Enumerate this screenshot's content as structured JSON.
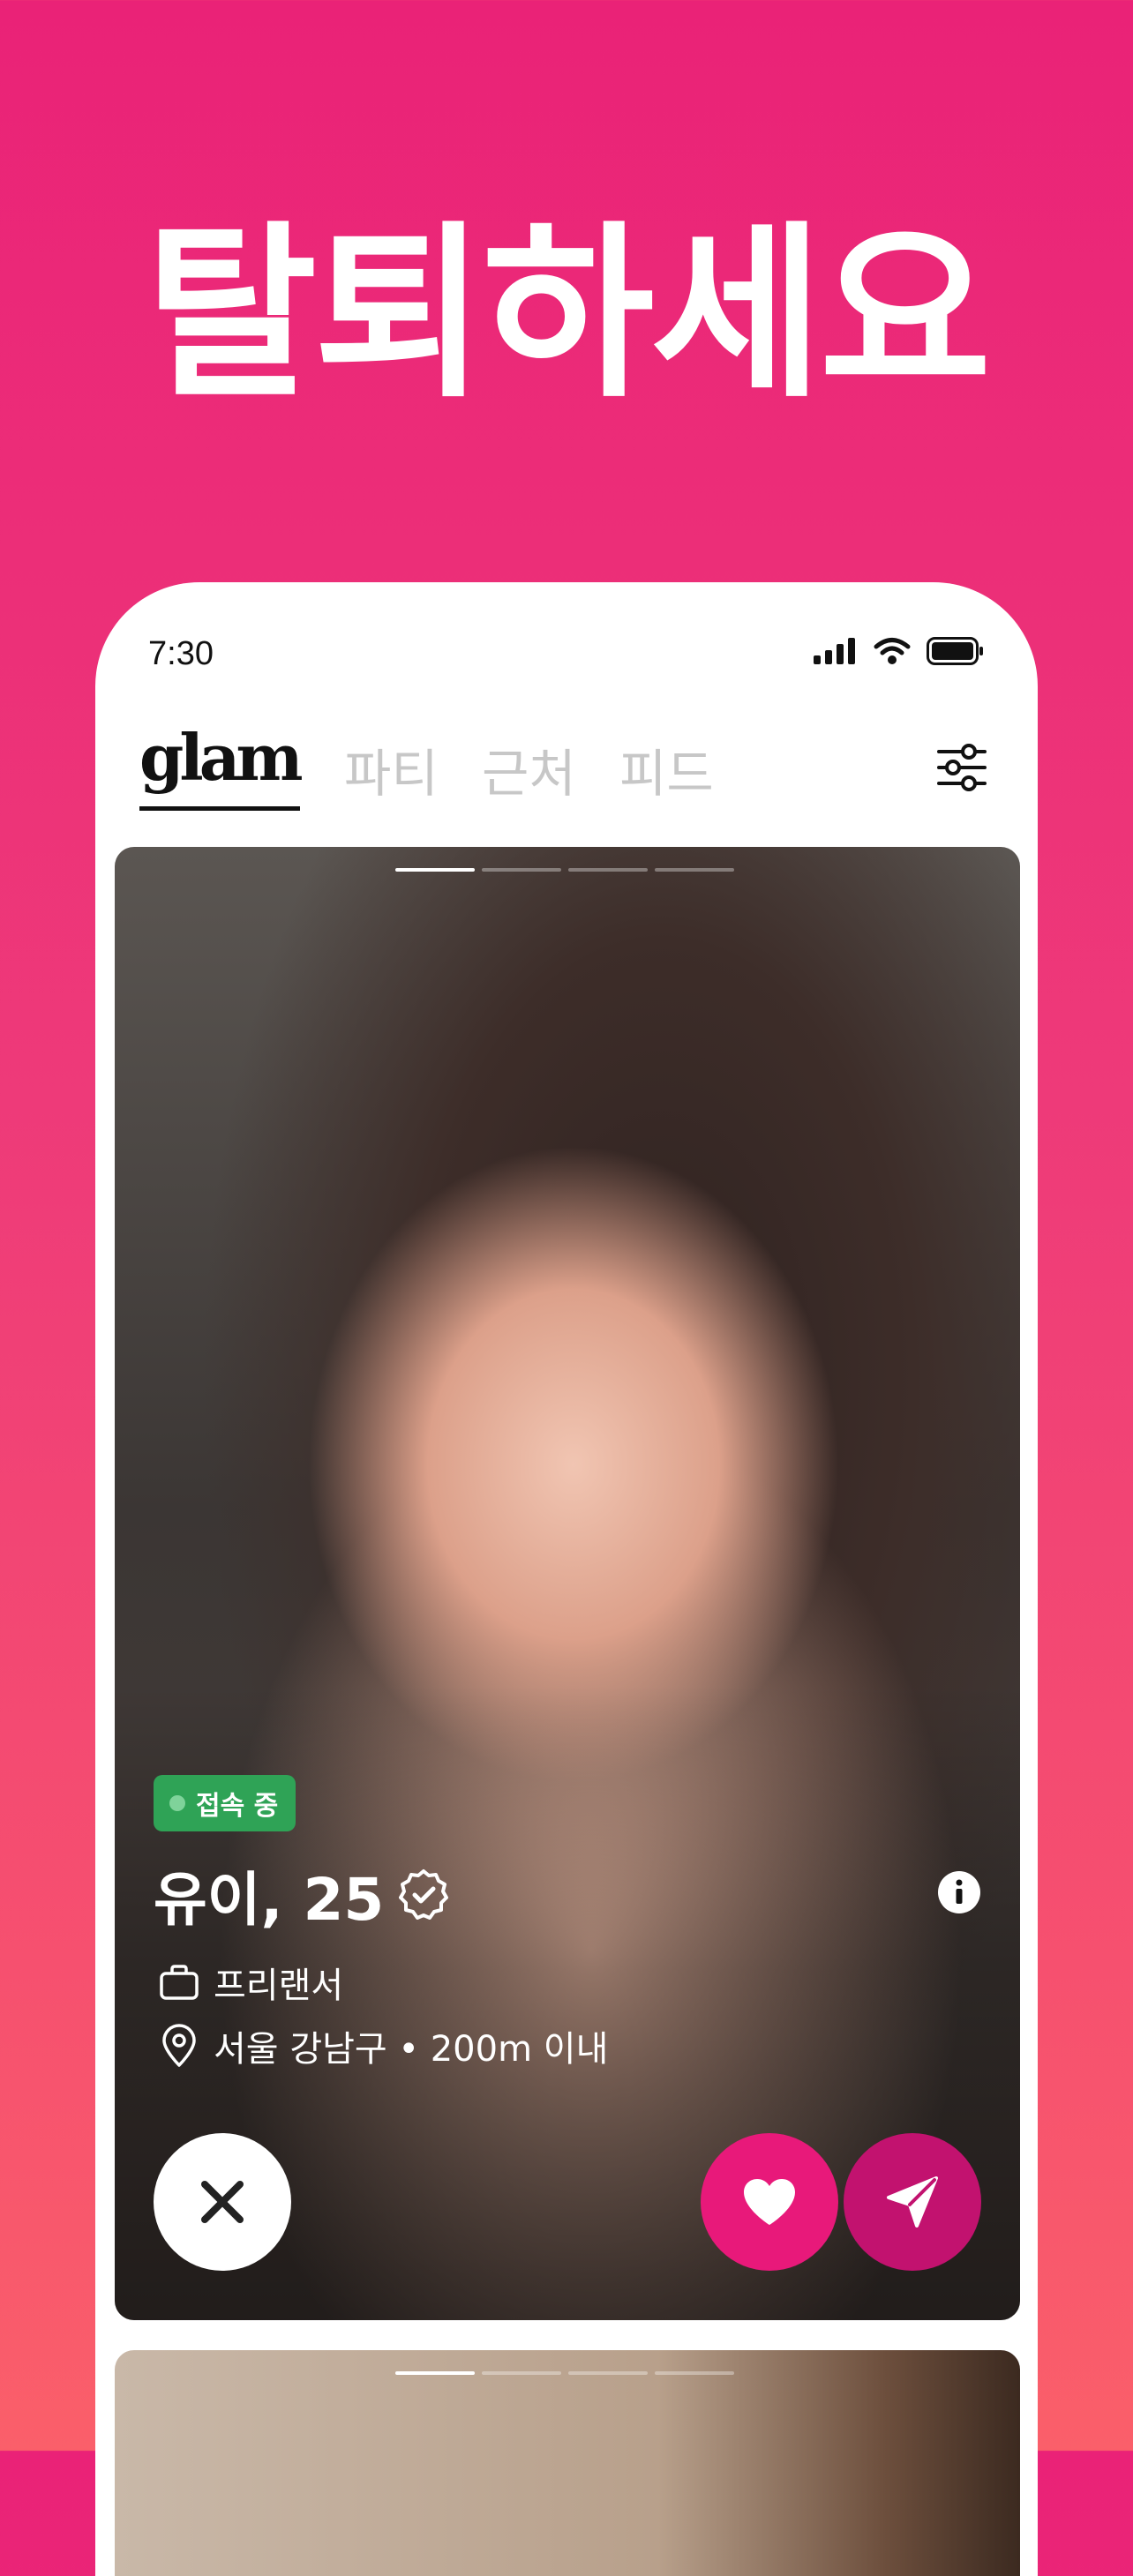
{
  "headline": "탈퇴하세요",
  "status_bar": {
    "time": "7:30",
    "icons": [
      "signal-icon",
      "wifi-icon",
      "battery-icon"
    ]
  },
  "nav": {
    "logo": "glam",
    "tabs": [
      "파티",
      "근처",
      "피드"
    ],
    "filter_icon": "sliders-icon"
  },
  "profile_card": {
    "photo_pages": 4,
    "active_page": 1,
    "status_badge": "접속 중",
    "name_age": "유이, 25",
    "verified_icon": "verified-badge-icon",
    "occupation": "프리랜서",
    "location": "서울 강남구 • 200m 이내",
    "actions": {
      "pass": "close-icon",
      "like": "heart-icon",
      "message": "send-icon"
    }
  },
  "colors": {
    "brand_pink": "#E8197A",
    "message_magenta": "#C2126F",
    "online_green": "#2FA356"
  }
}
